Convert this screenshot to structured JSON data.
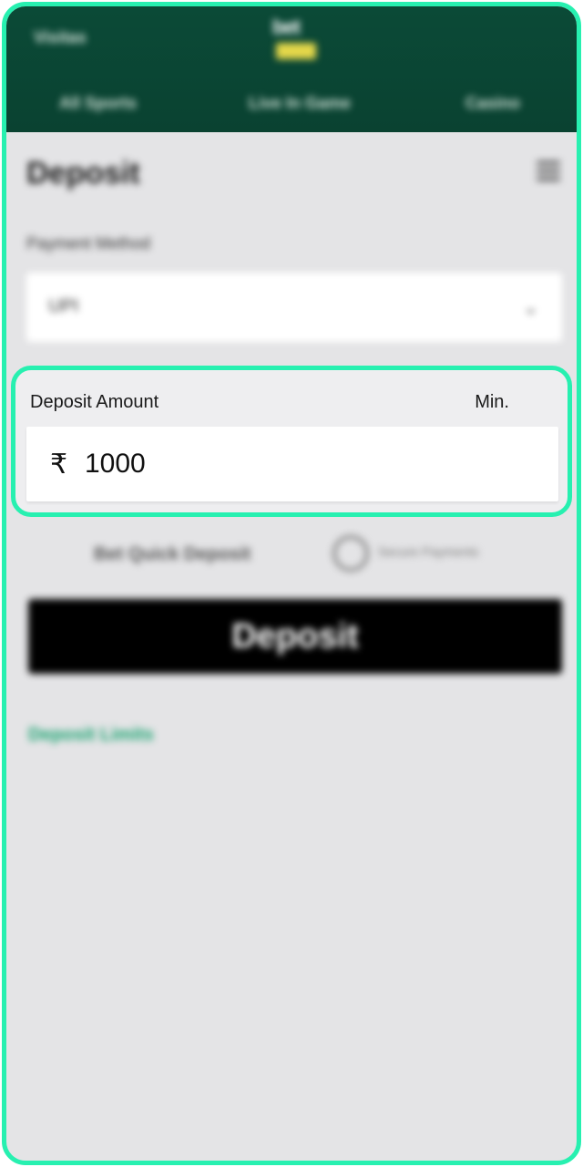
{
  "header": {
    "left_link": "Visitas",
    "logo_text": "bet",
    "tabs": [
      "All Sports",
      "Live In Game",
      "Casino"
    ]
  },
  "deposit_page": {
    "title": "Deposit",
    "payment_method_label": "Payment Method",
    "payment_method_value": "UPI",
    "amount": {
      "label": "Deposit Amount",
      "min_label": "Min.",
      "currency_symbol": "₹",
      "value": "1000"
    },
    "quick_text": "Bet Quick Deposit",
    "badge_text": "Secure Payments",
    "deposit_button": "Deposit",
    "limits_link": "Deposit Limits"
  },
  "colors": {
    "header_bg": "#0a4231",
    "highlight": "#27f0b0",
    "button_bg": "#000000",
    "link": "#17a36f",
    "logo_badge": "#e5d84a"
  }
}
